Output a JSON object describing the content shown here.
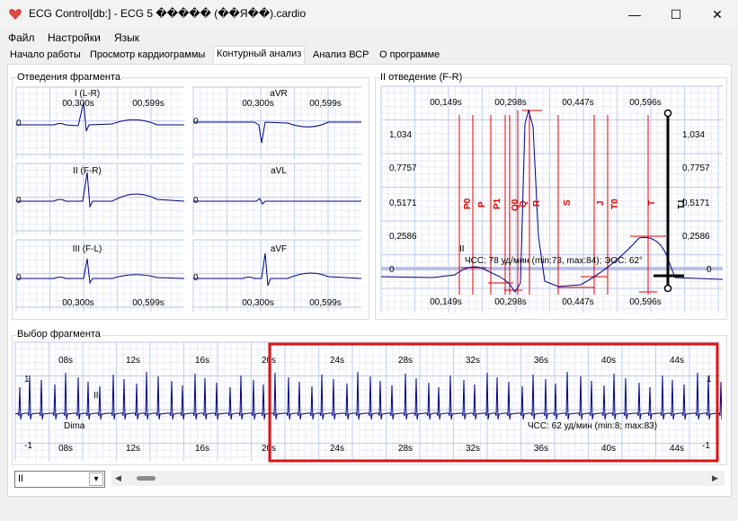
{
  "window": {
    "title": "ECG Control[db:] - ECG 5 ����� (��Я��).cardio",
    "minimize_glyph": "—",
    "maximize_glyph": "☐",
    "close_glyph": "✕"
  },
  "menu": [
    "Файл",
    "Настройки",
    "Язык"
  ],
  "tabs": [
    "Начало работы",
    "Просмотр кардиограммы",
    "Контурный анализ",
    "Анализ ВСР",
    "О программе"
  ],
  "active_tab": 2,
  "leads_panel": {
    "title": "Отведения фрагмента",
    "zero": "0",
    "time_labels": [
      "00,300s",
      "00,599s"
    ],
    "leads": [
      "I (L-R)",
      "aVR",
      "II (F-R)",
      "aVL",
      "III (F-L)",
      "aVF"
    ]
  },
  "lead_panel": {
    "title": "II отведение (F-R)",
    "time_labels": [
      "00,149s",
      "00,298s",
      "00,447s",
      "00,596s"
    ],
    "y_labels": [
      "1,034",
      "0,7757",
      "0,5171",
      "0,2586",
      "0"
    ],
    "markers": [
      "P0",
      "P",
      "P1",
      "Q0",
      "Q",
      "R",
      "S",
      "J",
      "T0",
      "T",
      "T1"
    ],
    "lead_name": "II",
    "hr_text": "ЧСС: 78 уд/мин (min:73, max:84); ЭОС: 62°"
  },
  "fragment_panel": {
    "title": "Выбор фрагмента",
    "time_labels": [
      "08s",
      "12s",
      "16s",
      "20s",
      "24s",
      "28s",
      "32s",
      "36s",
      "40s",
      "44s"
    ],
    "y_top": "1",
    "y_bottom": "-1",
    "lead_name": "II",
    "patient": "Dima",
    "hr_text": "ЧСС: 62 уд/мин (min:8; max:83)"
  },
  "lead_select": {
    "value": "II",
    "arrow": "▾"
  },
  "scroll": {
    "left_arrow": "◀",
    "right_arrow": "▶",
    "position_fraction": 0.02
  },
  "colors": {
    "trace": "#000080",
    "grid_major": "#c8d0ee",
    "grid_minor": "#e4e8f8",
    "marker": "#e00000",
    "selection": "#e01010",
    "title_icon": "#e04040"
  }
}
